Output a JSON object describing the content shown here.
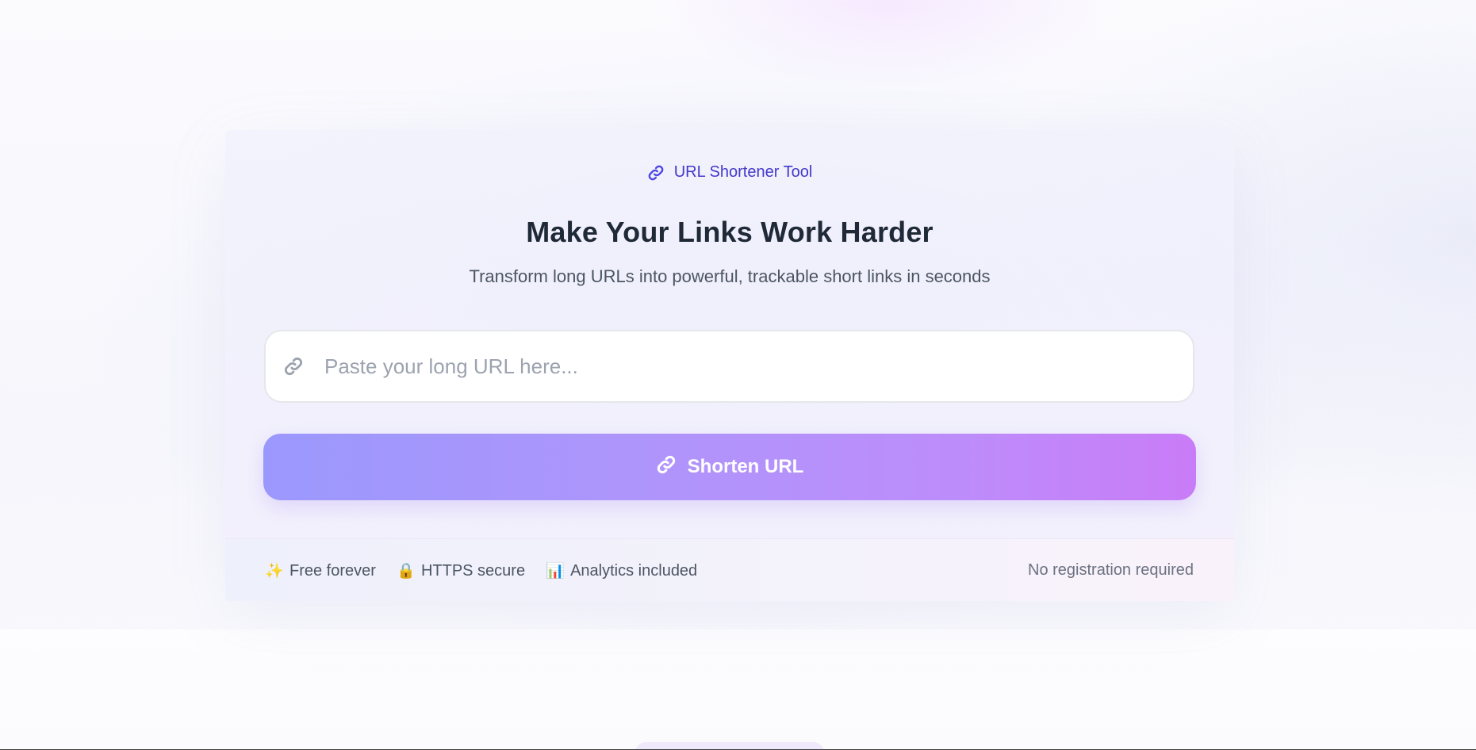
{
  "badge": {
    "icon": "link-icon",
    "label": "URL Shortener Tool"
  },
  "hero": {
    "title": "Make Your Links Work Harder",
    "subtitle": "Transform long URLs into powerful, trackable short links in seconds"
  },
  "url_input": {
    "icon": "link-icon",
    "value": "",
    "placeholder": "Paste your long URL here..."
  },
  "shorten_button": {
    "icon": "link-icon",
    "label": "Shorten URL"
  },
  "features": [
    {
      "icon": "sparkles-icon",
      "glyph": "✨",
      "label": "Free forever"
    },
    {
      "icon": "lock-icon",
      "glyph": "🔒",
      "label": "HTTPS secure"
    },
    {
      "icon": "bar-chart-icon",
      "glyph": "📊",
      "label": "Analytics included"
    }
  ],
  "no_registration": "No registration required",
  "colors": {
    "accent": "#4338ca",
    "title": "#1f2937",
    "button_gradient_start": "#9b98fd",
    "button_gradient_end": "#c97cf7"
  }
}
